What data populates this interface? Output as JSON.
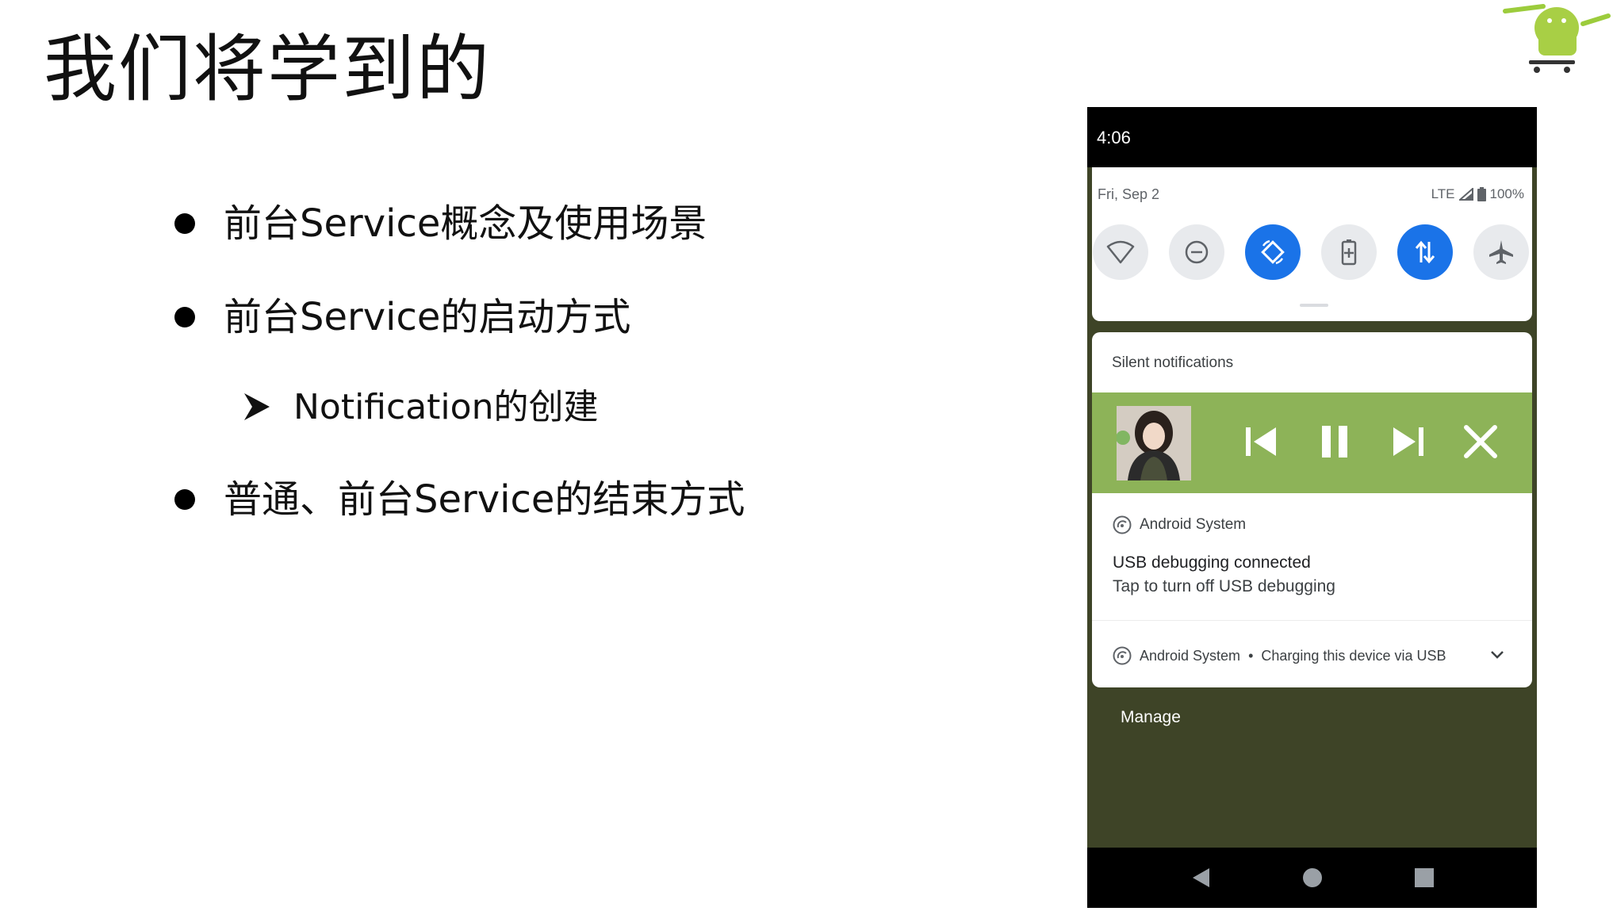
{
  "slide": {
    "title": "我们将学到的",
    "bullets": [
      "前台Service概念及使用场景",
      "前台Service的启动方式",
      "普通、前台Service的结束方式"
    ],
    "sub_bullet": "Notification的创建"
  },
  "phone": {
    "status_bar": {
      "time": "4:06"
    },
    "quick_settings": {
      "date": "Fri, Sep 2",
      "network": "LTE",
      "battery": "100%",
      "tiles": [
        {
          "icon": "wifi-icon",
          "active": false
        },
        {
          "icon": "do-not-disturb-icon",
          "active": false
        },
        {
          "icon": "auto-rotate-icon",
          "active": true
        },
        {
          "icon": "battery-saver-icon",
          "active": false
        },
        {
          "icon": "mobile-data-icon",
          "active": true
        },
        {
          "icon": "airplane-mode-icon",
          "active": false
        }
      ],
      "active_color": "#1a73e8"
    },
    "notifications": {
      "section_header": "Silent notifications",
      "media": {
        "background_color": "#8db358",
        "controls": [
          "previous-icon",
          "pause-icon",
          "next-icon",
          "close-icon"
        ]
      },
      "system": {
        "app_name": "Android System",
        "title": "USB debugging connected",
        "text": "Tap to turn off USB debugging"
      },
      "collapsed": {
        "app_name": "Android System",
        "separator": "•",
        "text": "Charging this device via USB"
      }
    },
    "manage_label": "Manage",
    "nav": [
      "back-icon",
      "home-icon",
      "recents-icon"
    ]
  }
}
